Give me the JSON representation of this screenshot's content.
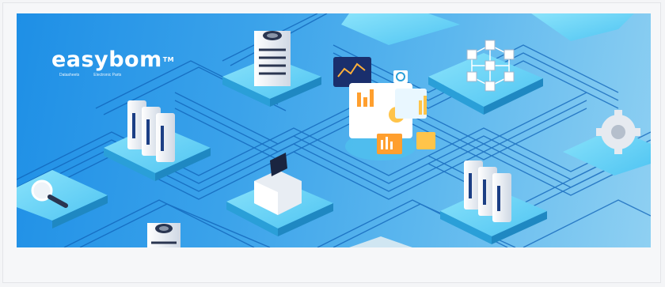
{
  "banner": {
    "logo": {
      "word": "easybom",
      "trademark": "TM",
      "tag_left": "Datasheets",
      "tag_right": "Electronic Parts"
    },
    "colors": {
      "bg_start": "#1e8fe6",
      "bg_end": "#8fd0f2",
      "tile": "#59c7f2",
      "circuit": "#0f5fb5"
    },
    "illustration": [
      "server-tower-icon",
      "server-rack-icon",
      "laptop-icon",
      "magnifier-icon",
      "gear-icon",
      "network-cube-icon",
      "analytics-dashboard-icon"
    ]
  }
}
